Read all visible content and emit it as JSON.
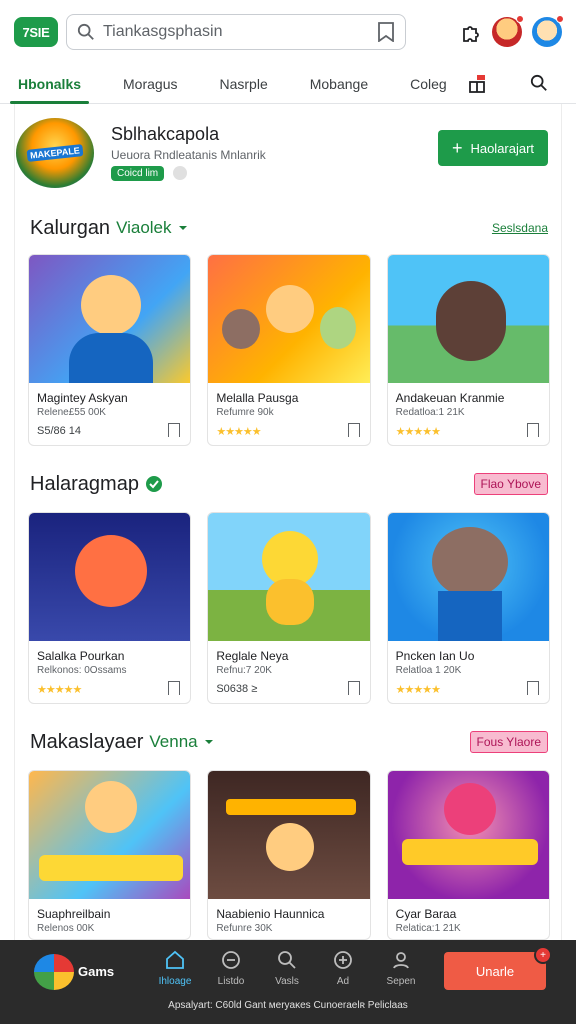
{
  "topbar": {
    "logo": "7SIE",
    "search_placeholder": "Tiankasgsphasin"
  },
  "tabs": [
    {
      "label": "Hbonalks",
      "active": true
    },
    {
      "label": "Moragus"
    },
    {
      "label": "Nasrple"
    },
    {
      "label": "Mobange"
    },
    {
      "label": "Coleg"
    }
  ],
  "developer": {
    "badge_text": "MAKEPALE",
    "name": "Sblhakcapola",
    "subtitle": "Ueuora Rndleatanis Mnlanrik",
    "tag": "Coicd lim",
    "follow_label": "Haolarajart"
  },
  "sections": [
    {
      "title": "Kalurgan",
      "subtitle": "Viaolek",
      "link": "Seslsdana",
      "cards": [
        {
          "name": "Magintey Askyan",
          "meta": "Relene£55 00K",
          "price": "S5/86 14"
        },
        {
          "name": "Melalla Pausga",
          "meta": "Refumre 90k",
          "rating": "★★★★★"
        },
        {
          "name": "Andakeuan Kranmie",
          "meta": "Redatloa:1 21K",
          "rating": "★★★★★"
        }
      ]
    },
    {
      "title": "Halaragmap",
      "pill": "Flao Ybove",
      "cards": [
        {
          "name": "Salalka Pourkan",
          "meta": "Relkonos: 0Ossams",
          "rating": "★★★★★"
        },
        {
          "name": "Reglale Neya",
          "meta": "Refnu:7 20K",
          "price": "S0638 ≥"
        },
        {
          "name": "Pncken Ian Uo",
          "meta": "Relatloa 1 20K",
          "rating": "★★★★★"
        }
      ]
    },
    {
      "title": "Makaslayaer",
      "subtitle": "Venna",
      "pill": "Fous Ylaore",
      "cards": [
        {
          "name": "Suaphreilbain",
          "meta": "Relenos 00K"
        },
        {
          "name": "Naabienio Haunnica",
          "meta": "Refunre 30K"
        },
        {
          "name": "Cyar Baraa",
          "meta": "Relatica:1 21K"
        }
      ]
    }
  ],
  "bottom": {
    "brand": "Gams",
    "nav": [
      {
        "label": "Ihloage",
        "active": true
      },
      {
        "label": "Listdo"
      },
      {
        "label": "Vasls"
      },
      {
        "label": "Ad"
      },
      {
        "label": "Sepen"
      }
    ],
    "cta": "Unarle",
    "cta_badge": "+",
    "footer": "Apsalyart: C60ld Gant  ᴍeryaᴋes Cunoeraelʀ Peliclaas"
  },
  "colors": {
    "accent": "#1e9b4a",
    "cta": "#ef5b45",
    "pill": "#f8bbd0"
  }
}
